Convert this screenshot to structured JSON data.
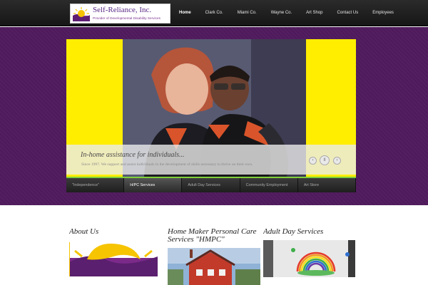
{
  "logo": {
    "name": "Self-Reliance, Inc.",
    "tagline": "Provider of Developmental Disability Services"
  },
  "nav": {
    "items": [
      {
        "label": "Home",
        "active": true
      },
      {
        "label": "Clark Co.",
        "active": false
      },
      {
        "label": "Miami Co.",
        "active": false
      },
      {
        "label": "Wayne Co.",
        "active": false
      },
      {
        "label": "Art Shop",
        "active": false
      },
      {
        "label": "Contact Us",
        "active": false
      },
      {
        "label": "Employees",
        "active": false
      }
    ]
  },
  "slider": {
    "caption_title": "In-home assistance for individuals...",
    "caption_text": "Since 1997. We support and assist individuals in the development of skills necessary to thrive on their own.",
    "controls": {
      "prev": "‹",
      "pause": "II",
      "next": "›"
    },
    "tabs": [
      {
        "label": "\"Independence\"",
        "active": false
      },
      {
        "label": "H/PC Services",
        "active": true
      },
      {
        "label": "Adult Day Services",
        "active": false
      },
      {
        "label": "Community Employment",
        "active": false
      },
      {
        "label": "Art Store",
        "active": false
      }
    ]
  },
  "columns": [
    {
      "title": "About Us"
    },
    {
      "title": "Home Maker Personal Care Services \"HMPC\""
    },
    {
      "title": "Adult Day Services"
    }
  ],
  "colors": {
    "header": "#1c1c1c",
    "band": "#4f1a5c",
    "slider_bg": "#ffee00",
    "tab_accent": "#7fd03a",
    "logo_text": "#5a2a86"
  }
}
